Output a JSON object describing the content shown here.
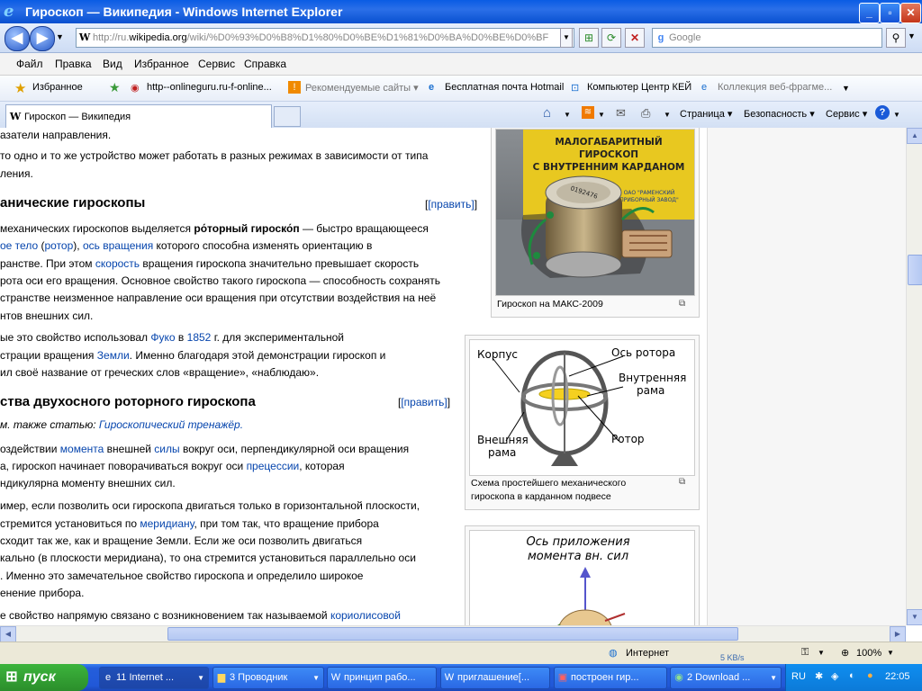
{
  "window": {
    "title": "Гироскоп — Википедия - Windows Internet Explorer",
    "minimize": "_",
    "maximize": "▫",
    "close": "✕"
  },
  "address": {
    "prefix": "http://ru.",
    "host": "wikipedia.org",
    "path": "/wiki/%D0%93%D0%B8%D1%80%D0%BE%D1%81%D0%BA%D0%BE%D0%BF",
    "search_placeholder": "Google"
  },
  "menu": [
    "Файл",
    "Правка",
    "Вид",
    "Избранное",
    "Сервис",
    "Справка"
  ],
  "favorites": {
    "label": "Избранное",
    "items": [
      "http--onlineguru.ru-f-online...",
      "Рекомендуемые сайты ▾",
      "Бесплатная почта Hotmail",
      "Компьютер Центр КЕЙ",
      "Коллекция веб-фрагме..."
    ]
  },
  "tabs": {
    "active": "Гироскоп — Википедия"
  },
  "commands": [
    "Страница ▾",
    "Безопасность ▾",
    "Сервис ▾"
  ],
  "article": {
    "l1": "азатели направления.",
    "l2": "то одно и то же устройство может работать в разных режимах в зависимости от типа",
    "l3": "ления.",
    "h_mech": "анические гироскопы",
    "edit": "[править]",
    "p1": [
      "механических гироскопов выделяется",
      "ро́торный гироско́п",
      "— быстро вращающееся",
      "ое тело",
      "(",
      "ротор",
      "),",
      "ось вращения",
      "которого способна изменять ориентацию в",
      "ранстве. При этом",
      "скорость",
      "вращения гироскопа значительно превышает скорость",
      "рота оси его вращения. Основное свойство такого гироскопа — способность сохранять",
      "странстве неизменное направление оси вращения при отсутствии воздействия на неё",
      "нтов внешних сил."
    ],
    "p2": [
      "ые это свойство использовал",
      "Фуко",
      "в",
      "1852",
      "г. для экспериментальной",
      "страции вращения",
      "Земли",
      ". Именно благодаря этой демонстрации гироскоп и",
      "ил своё название от греческих слов «вращение», «наблюдаю»."
    ],
    "h_props": "ства двухосного роторного гироскопа",
    "see_also": "м. также статью:",
    "see_also_link": "Гироскопический тренажёр.",
    "p3": [
      "оздействии",
      "момента",
      "внешней",
      "силы",
      "вокруг оси, перпендикулярной оси вращения",
      "а, гироскоп начинает поворачиваться вокруг оси",
      "прецессии",
      ", которая",
      "ндикулярна моменту внешних сил."
    ],
    "p4": [
      "имер, если позволить оси гироскопа двигаться только в горизонтальной плоскости,",
      "стремится установиться по",
      "меридиану",
      ", при том так, что вращение прибора",
      "сходит так же, как и вращение Земли. Если же оси позволить двигаться",
      "кально (в плоскости меридиана), то она стремится установиться параллельно оси",
      ". Именно это замечательное свойство гироскопа и определило широкое",
      "енение прибора."
    ],
    "p5": [
      "е свойство напрямую связано с возникновением так называемой",
      "кориолисовой"
    ]
  },
  "figures": {
    "fig1": {
      "sign": [
        "МАЛОГАБАРИТНЫЙ",
        "ГИРОСКОП",
        "С ВНУТРЕННИМ КАРДАНОМ"
      ],
      "serial": "0192476",
      "maker": [
        "ОАО \"РАМЕНСКИЙ",
        "ПРИБОРНЫЙ ЗАВОД\""
      ],
      "caption": "Гироскоп на МАКС-2009"
    },
    "fig2": {
      "labels": [
        "Корпус",
        "Ось ротора",
        "Внутренняя",
        "рама",
        "Ротор",
        "Внешняя",
        "рама"
      ],
      "caption": [
        "Схема простейшего механического",
        "гироскопа в карданном подвесе"
      ]
    },
    "fig3": {
      "labels": [
        "Ось приложения",
        "момента  вн. сил"
      ]
    }
  },
  "status": {
    "zone": "Интернет",
    "zoom": "100%",
    "speed": "5 KB/s"
  },
  "taskbar": {
    "start": "пуск",
    "tasks": [
      "11 Internet ...",
      "3 Проводник",
      "принцип рабо...",
      "приглашение[...",
      "построен гир...",
      "2 Download ..."
    ],
    "lang": "RU",
    "time": "22:05"
  },
  "colors": {
    "link": "#0645ad",
    "titlebar": "#0a5ce4",
    "taskbar": "#245edb",
    "start": "#3cb43c"
  }
}
